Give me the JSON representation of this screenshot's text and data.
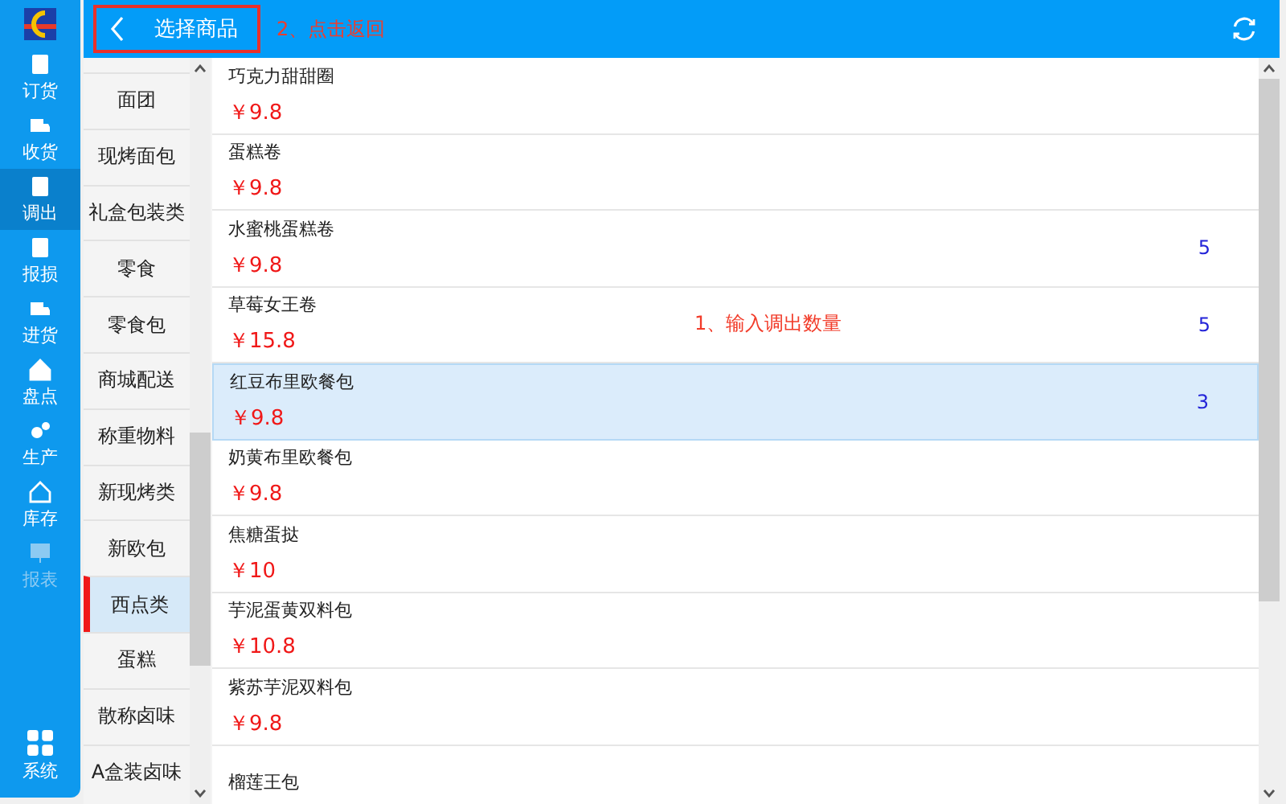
{
  "nav": {
    "items": [
      {
        "label": "订货",
        "selected": false,
        "disabled": false
      },
      {
        "label": "收货",
        "selected": false,
        "disabled": false
      },
      {
        "label": "调出",
        "selected": true,
        "disabled": false
      },
      {
        "label": "报损",
        "selected": false,
        "disabled": false
      },
      {
        "label": "进货",
        "selected": false,
        "disabled": false
      },
      {
        "label": "盘点",
        "selected": false,
        "disabled": false
      },
      {
        "label": "生产",
        "selected": false,
        "disabled": false
      },
      {
        "label": "库存",
        "selected": false,
        "disabled": false
      },
      {
        "label": "报表",
        "selected": false,
        "disabled": true
      }
    ],
    "bottom": {
      "label": "系统",
      "selected": false,
      "disabled": false
    }
  },
  "header": {
    "title": "选择商品",
    "highlighted": true,
    "note": "2、点击返回"
  },
  "categories": [
    {
      "label": "面团",
      "selected": false
    },
    {
      "label": "现烤面包",
      "selected": false
    },
    {
      "label": "礼盒包装类",
      "selected": false
    },
    {
      "label": "零食",
      "selected": false
    },
    {
      "label": "零食包",
      "selected": false
    },
    {
      "label": "商城配送",
      "selected": false
    },
    {
      "label": "称重物料",
      "selected": false
    },
    {
      "label": "新现烤类",
      "selected": false
    },
    {
      "label": "新欧包",
      "selected": false
    },
    {
      "label": "西点类",
      "selected": true
    },
    {
      "label": "蛋糕",
      "selected": false
    },
    {
      "label": "散称卤味",
      "selected": false
    },
    {
      "label": "A盒装卤味",
      "selected": false
    }
  ],
  "products": [
    {
      "name": "巧克力甜甜圈",
      "price": "￥9.8",
      "selected": false
    },
    {
      "name": "蛋糕卷",
      "price": "￥9.8",
      "selected": false
    },
    {
      "name": "水蜜桃蛋糕卷",
      "price": "￥9.8",
      "quantity": "5",
      "selected": false
    },
    {
      "name": "草莓女王卷",
      "price": "￥15.8",
      "quantity": "5",
      "note": "1、输入调出数量",
      "selected": false
    },
    {
      "name": "红豆布里欧餐包",
      "price": "￥9.8",
      "quantity": "3",
      "selected": true
    },
    {
      "name": "奶黄布里欧餐包",
      "price": "￥9.8",
      "selected": false
    },
    {
      "name": "焦糖蛋挞",
      "price": "￥10",
      "selected": false
    },
    {
      "name": "芋泥蛋黄双料包",
      "price": "￥10.8",
      "selected": false
    },
    {
      "name": "紫苏芋泥双料包",
      "price": "￥9.8",
      "selected": false
    },
    {
      "name": "榴莲王包",
      "selected": false
    }
  ]
}
